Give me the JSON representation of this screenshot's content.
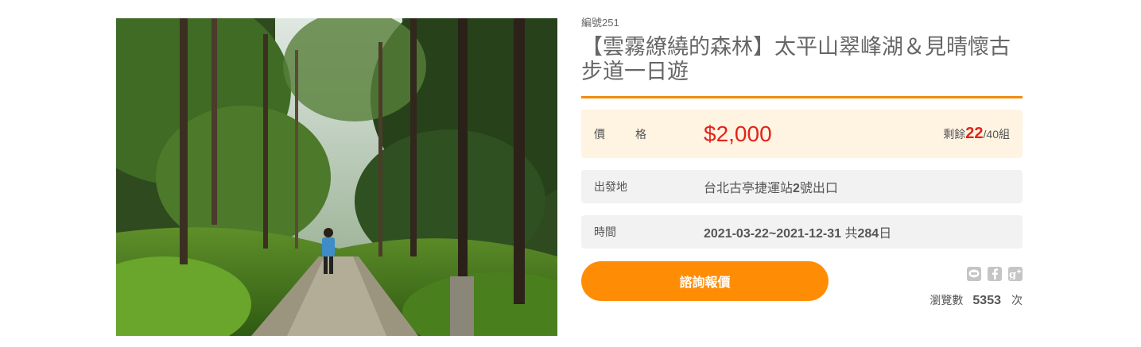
{
  "photo": {
    "alt": "Forest trail with hiker"
  },
  "tour": {
    "serial": "編號251",
    "title": "【雲霧繚繞的森林】太平山翠峰湖＆見晴懷古步道一日遊"
  },
  "price_row": {
    "label": "價　格",
    "price": "$2,000",
    "remain_prefix": "剩餘",
    "remain_count": "22",
    "remain_suffix": "/40組"
  },
  "origin_row": {
    "label": "出發地",
    "value_part1": "台北古亭捷運站",
    "value_bold": "2",
    "value_part2": "號出口"
  },
  "time_row": {
    "label": "時間",
    "range": "2021-03-22~2021-12-31",
    "total_prefix": "共",
    "total_days": "284",
    "total_suffix": "日"
  },
  "cta": {
    "label": "諮詢報價"
  },
  "share": {
    "icons": [
      "line-icon",
      "facebook-icon",
      "google-plus-icon"
    ]
  },
  "views": {
    "label": "瀏覽數",
    "count": "5353",
    "unit": "次"
  },
  "colors": {
    "accent": "#ff8c05",
    "divider": "#f08c0a",
    "price": "#e2231a",
    "price_bg": "#fff3e2",
    "row_bg": "#f2f2f2"
  }
}
